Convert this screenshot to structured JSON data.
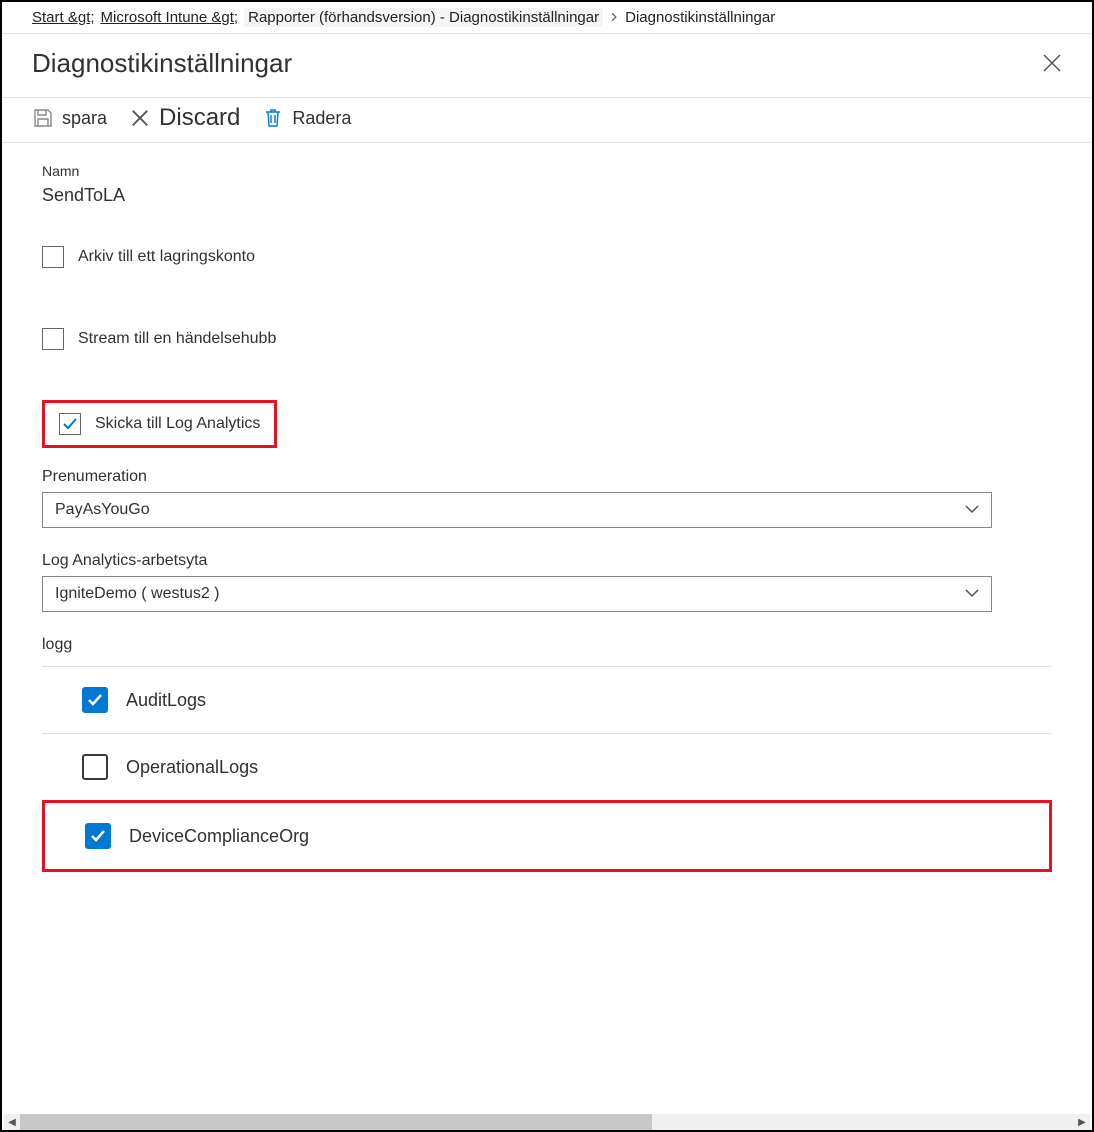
{
  "breadcrumbs": {
    "start": "Start &gt;",
    "intune": "Microsoft Intune &gt;",
    "reports": "Rapporter (förhandsversion) - Diagnostikinställningar",
    "final": "Diagnostikinställningar"
  },
  "blade": {
    "title": "Diagnostikinställningar"
  },
  "toolbar": {
    "save_label": "spara",
    "discard_label": "Discard",
    "delete_label": "Radera"
  },
  "form": {
    "name_label": "Namn",
    "name_value": "SendToLA",
    "archive_storage_label": "Arkiv till ett lagringskonto",
    "stream_eventhub_label": "Stream till en händelsehubb",
    "send_log_analytics_label": "Skicka till Log Analytics"
  },
  "subscription": {
    "label": "Prenumeration",
    "value": "PayAsYouGo"
  },
  "workspace": {
    "label": "Log Analytics-arbetsyta",
    "value": "IgniteDemo ( westus2 )"
  },
  "logs": {
    "heading": "logg",
    "items": [
      {
        "label": "AuditLogs",
        "checked": true
      },
      {
        "label": "OperationalLogs",
        "checked": false
      },
      {
        "label": "DeviceComplianceOrg",
        "checked": true
      }
    ]
  }
}
